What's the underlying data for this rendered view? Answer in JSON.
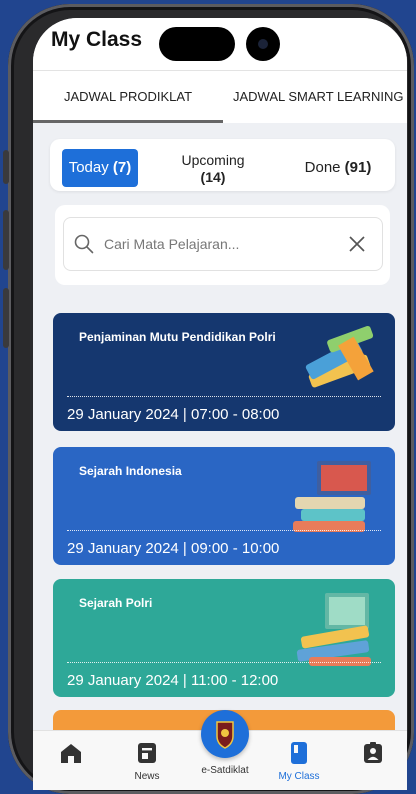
{
  "header": {
    "title": "My Class"
  },
  "tabs": [
    {
      "label": "JADWAL PRODIKLAT",
      "active": true
    },
    {
      "label": "JADWAL SMART LEARNING",
      "active": false
    }
  ],
  "filters": {
    "today": {
      "label": "Today",
      "count": "(7)"
    },
    "upcoming": {
      "label": "Upcoming",
      "count": "(14)"
    },
    "done": {
      "label": "Done",
      "count": "(91)"
    }
  },
  "search": {
    "placeholder": "Cari Mata Pelajaran..."
  },
  "courses": [
    {
      "title": "Penjaminan Mutu Pendidikan Polri",
      "time": "29 January 2024 | 07:00 - 08:00",
      "color": "#15376f"
    },
    {
      "title": "Sejarah Indonesia",
      "time": "29 January 2024 | 09:00 - 10:00",
      "color": "#2a66c4"
    },
    {
      "title": "Sejarah Polri",
      "time": "29 January 2024 | 11:00 - 12:00",
      "color": "#2ea898"
    }
  ],
  "bottom_nav": {
    "center_label": "e-Satdiklat",
    "items": [
      {
        "icon": "home-icon",
        "label": ""
      },
      {
        "icon": "news-icon",
        "label": "News"
      },
      {
        "icon": "book-icon",
        "label": "My Class",
        "active": true,
        "active_color": "#1e6fd9"
      },
      {
        "icon": "profile-badge-icon",
        "label": ""
      }
    ]
  }
}
